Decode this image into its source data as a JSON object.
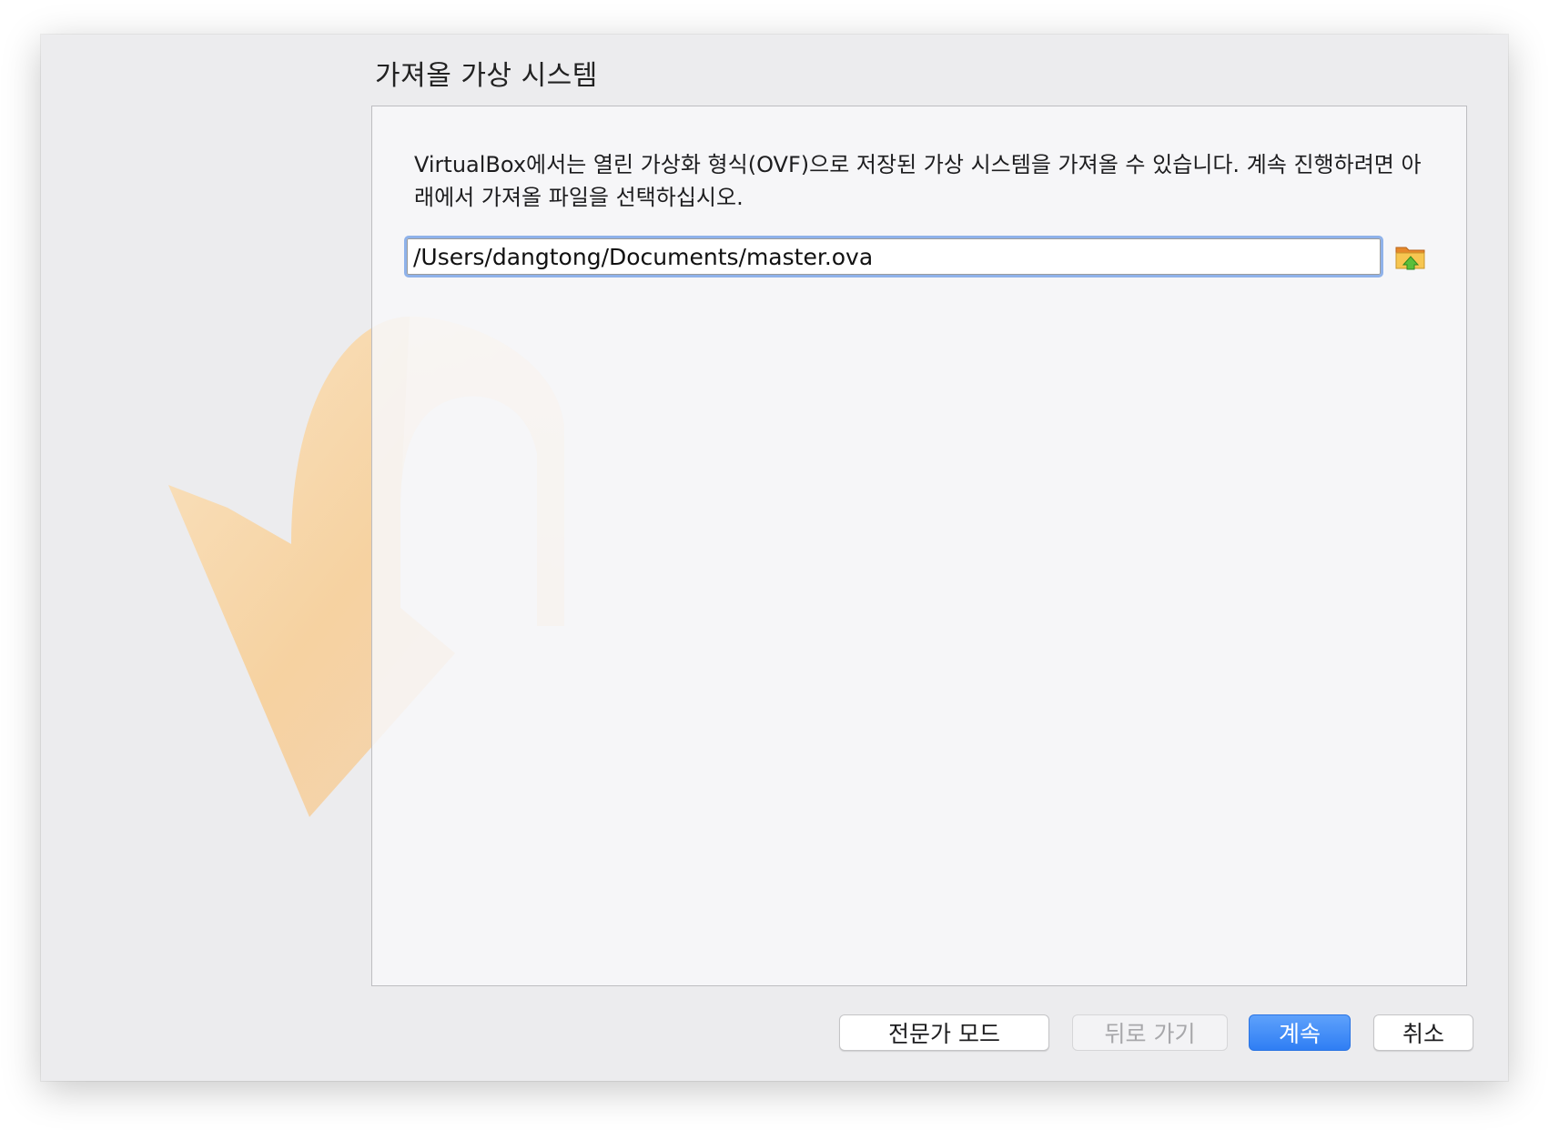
{
  "wizard": {
    "title": "가져올 가상 시스템",
    "description": "VirtualBox에서는 열린 가상화 형식(OVF)으로 저장된 가상 시스템을 가져올 수 있습니다. 계속 진행하려면 아래에서 가져올 파일을 선택하십시오.",
    "file_input": {
      "value": "/Users/dangtong/Documents/master.ova",
      "focused": true
    },
    "browse_icon": "folder-open-icon",
    "watermark_icon": "import-arrow-icon"
  },
  "buttons": {
    "expert_mode": "전문가 모드",
    "back": "뒤로 가기",
    "continue": "계속",
    "cancel": "취소"
  },
  "colors": {
    "primary_button": "#3b87f7",
    "focus_ring": "#8fb2ea",
    "watermark": "#f5c98c"
  }
}
